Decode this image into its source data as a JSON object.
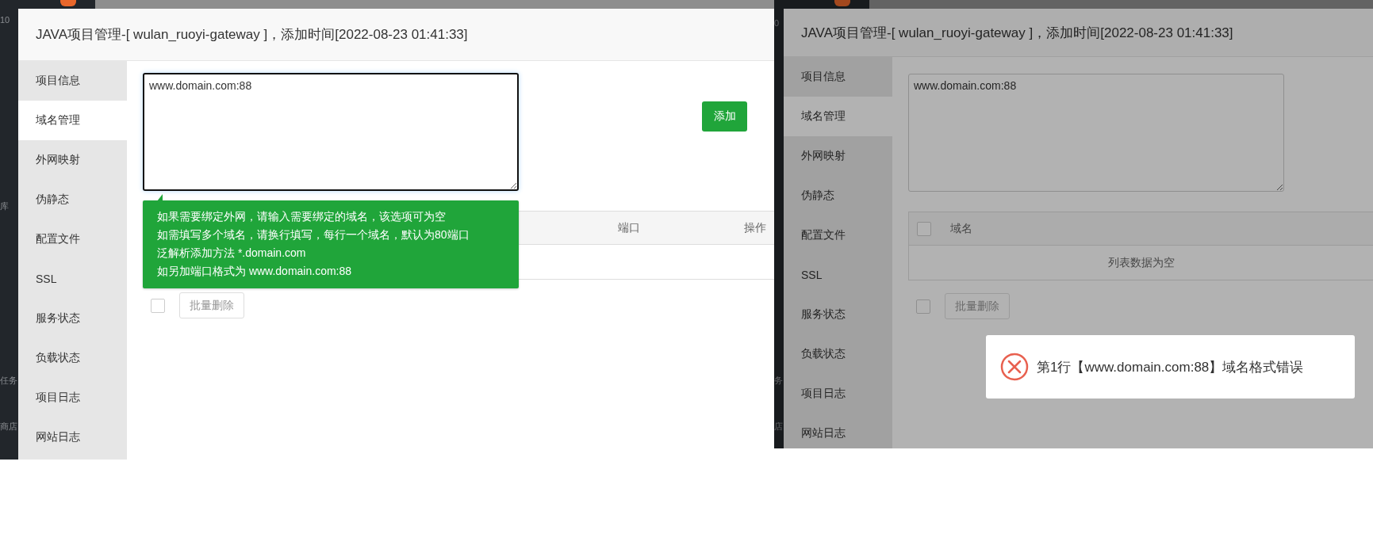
{
  "screens": [
    {
      "fragments": [
        "10",
        "库",
        "任务",
        "商店"
      ],
      "dialog": {
        "title": "JAVA项目管理-[ wulan_ruoyi-gateway ]，添加时间[2022-08-23 01:41:33]",
        "sidebar": [
          {
            "label": "项目信息",
            "selected": false
          },
          {
            "label": "域名管理",
            "selected": true
          },
          {
            "label": "外网映射",
            "selected": false
          },
          {
            "label": "伪静态",
            "selected": false
          },
          {
            "label": "配置文件",
            "selected": false
          },
          {
            "label": "SSL",
            "selected": false
          },
          {
            "label": "服务状态",
            "selected": false
          },
          {
            "label": "负载状态",
            "selected": false
          },
          {
            "label": "项目日志",
            "selected": false
          },
          {
            "label": "网站日志",
            "selected": false
          }
        ],
        "domain_input": {
          "value": "www.domain.com:88",
          "focused": true
        },
        "add_button": "添加",
        "tooltip": [
          "如果需要绑定外网，请输入需要绑定的域名，该选项可为空",
          "如需填写多个域名，请换行填写，每行一个域名，默认为80端口",
          "泛解析添加方法 *.domain.com",
          "如另加端口格式为 www.domain.com:88"
        ],
        "table": {
          "port_header": "端口",
          "action_header": "操作"
        },
        "footer": {
          "select_all": {
            "checked": false
          },
          "batch_delete": "批量删除"
        }
      },
      "dimmed": false
    },
    {
      "fragments": [
        "0",
        "务",
        "店"
      ],
      "dialog": {
        "title": "JAVA项目管理-[ wulan_ruoyi-gateway ]，添加时间[2022-08-23 01:41:33]",
        "sidebar": [
          {
            "label": "项目信息",
            "selected": false
          },
          {
            "label": "域名管理",
            "selected": true
          },
          {
            "label": "外网映射",
            "selected": false
          },
          {
            "label": "伪静态",
            "selected": false
          },
          {
            "label": "配置文件",
            "selected": false
          },
          {
            "label": "SSL",
            "selected": false
          },
          {
            "label": "服务状态",
            "selected": false
          },
          {
            "label": "负载状态",
            "selected": false
          },
          {
            "label": "项目日志",
            "selected": false
          },
          {
            "label": "网站日志",
            "selected": false
          }
        ],
        "domain_input": {
          "value": "www.domain.com:88",
          "focused": false
        },
        "table": {
          "select_all": {
            "checked": false
          },
          "domain_header": "域名",
          "empty_text": "列表数据为空"
        },
        "footer": {
          "select_all": {
            "checked": false
          },
          "batch_delete": "批量删除"
        }
      },
      "dimmed": true,
      "toast": {
        "kind": "error",
        "message": "第1行【www.domain.com:88】域名格式错误"
      }
    }
  ]
}
